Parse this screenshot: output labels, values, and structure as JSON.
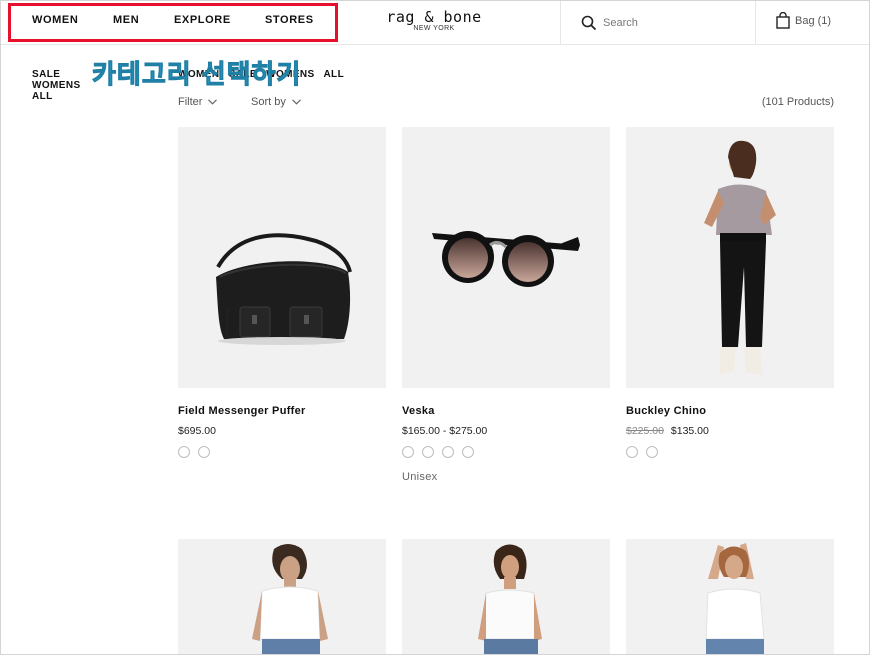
{
  "header": {
    "nav": [
      "WOMEN",
      "MEN",
      "EXPLORE",
      "STORES"
    ],
    "brand": "rag & bone",
    "city": "NEW YORK",
    "search_placeholder": "Search",
    "bag_label": "Bag (1)",
    "highlight_color": "#e8112d"
  },
  "caption": "카테고리 선택하기",
  "sidebar": [
    "SALE",
    "WOMENS",
    "ALL"
  ],
  "breadcrumb": [
    "WOMEN",
    "SALE",
    "WOMENS",
    "ALL"
  ],
  "filters": {
    "filter_label": "Filter",
    "sort_label": "Sort by",
    "count": "(101 Products)"
  },
  "products": [
    {
      "name": "Field Messenger Puffer",
      "price": "$695.00",
      "swatches": 2,
      "image": "black-messenger-bag"
    },
    {
      "name": "Veska",
      "price": "$165.00 - $275.00",
      "swatches": 4,
      "tag": "Unisex",
      "image": "black-sunglasses"
    },
    {
      "name": "Buckley Chino",
      "original_price": "$225.00",
      "price": "$135.00",
      "swatches": 2,
      "image": "model-black-chino"
    },
    {
      "image": "model-white-tank-1"
    },
    {
      "image": "model-white-tank-2"
    },
    {
      "image": "model-white-tee"
    }
  ]
}
